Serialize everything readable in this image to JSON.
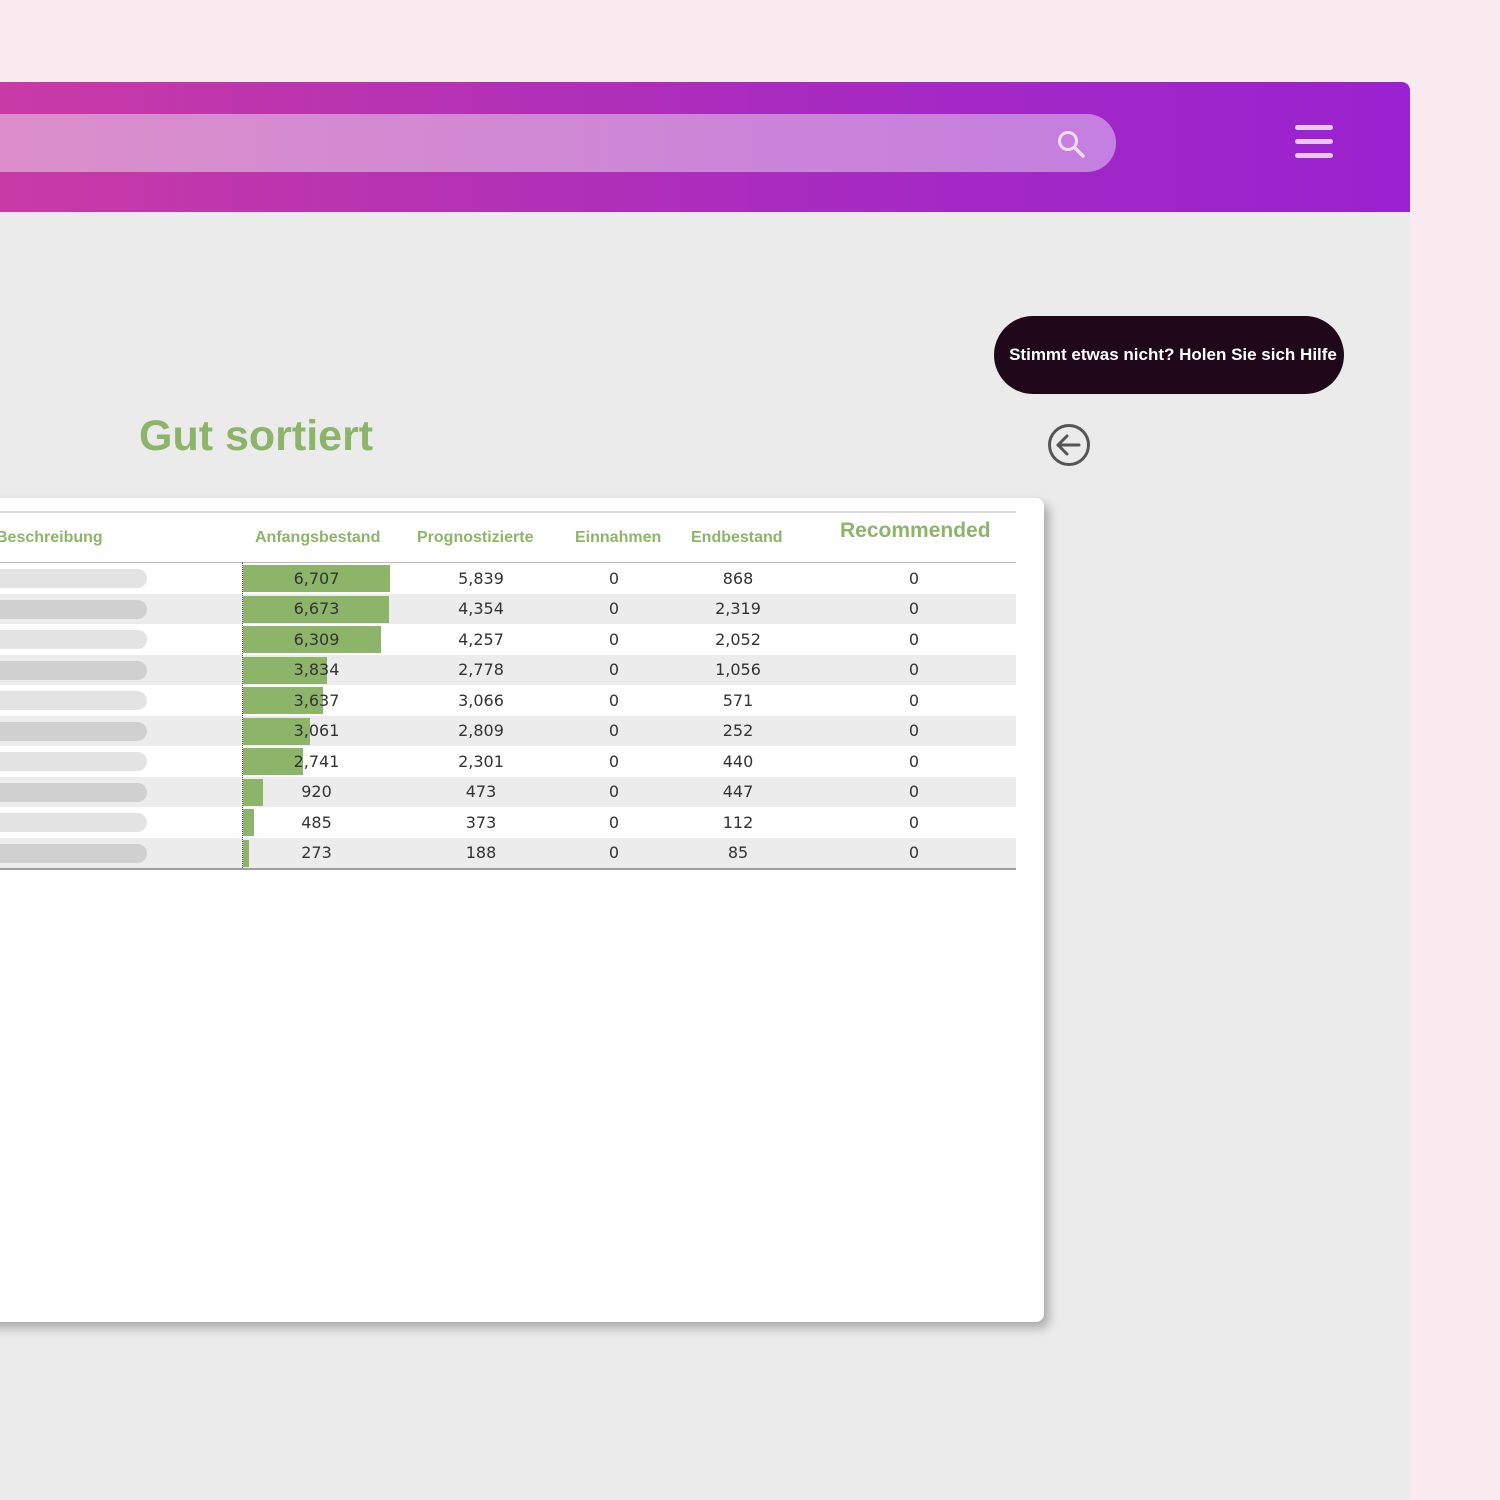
{
  "header": {
    "search": {
      "placeholder": "",
      "icon": "search-icon"
    },
    "menu_icon": "hamburger-menu-icon",
    "colors": {
      "gradient_start": "#c93aa6",
      "gradient_end": "#9a22d0"
    }
  },
  "help_button": {
    "label": "Stimmt etwas nicht? Holen Sie sich Hilfe"
  },
  "back_button": {
    "icon": "arrow-left-circle-icon"
  },
  "page": {
    "title": "Gut sortiert",
    "accent_color": "#8db56a"
  },
  "table": {
    "columns": {
      "beschreibung": "Beschreibung",
      "anfangsbestand": "Anfangsbestand",
      "prognostizierte": "Prognostizierte",
      "einnahmen": "Einnahmen",
      "endbestand": "Endbestand",
      "recommended": "Recommended"
    },
    "rows": [
      {
        "anfangsbestand": "6,707",
        "prognostizierte": "5,839",
        "einnahmen": "0",
        "endbestand": "868",
        "recommended": "0",
        "bar": 6707
      },
      {
        "anfangsbestand": "6,673",
        "prognostizierte": "4,354",
        "einnahmen": "0",
        "endbestand": "2,319",
        "recommended": "0",
        "bar": 6673
      },
      {
        "anfangsbestand": "6,309",
        "prognostizierte": "4,257",
        "einnahmen": "0",
        "endbestand": "2,052",
        "recommended": "0",
        "bar": 6309
      },
      {
        "anfangsbestand": "3,834",
        "prognostizierte": "2,778",
        "einnahmen": "0",
        "endbestand": "1,056",
        "recommended": "0",
        "bar": 3834
      },
      {
        "anfangsbestand": "3,637",
        "prognostizierte": "3,066",
        "einnahmen": "0",
        "endbestand": "571",
        "recommended": "0",
        "bar": 3637
      },
      {
        "anfangsbestand": "3,061",
        "prognostizierte": "2,809",
        "einnahmen": "0",
        "endbestand": "252",
        "recommended": "0",
        "bar": 3061
      },
      {
        "anfangsbestand": "2,741",
        "prognostizierte": "2,301",
        "einnahmen": "0",
        "endbestand": "440",
        "recommended": "0",
        "bar": 2741
      },
      {
        "anfangsbestand": "920",
        "prognostizierte": "473",
        "einnahmen": "0",
        "endbestand": "447",
        "recommended": "0",
        "bar": 920
      },
      {
        "anfangsbestand": "485",
        "prognostizierte": "373",
        "einnahmen": "0",
        "endbestand": "112",
        "recommended": "0",
        "bar": 485
      },
      {
        "anfangsbestand": "273",
        "prognostizierte": "188",
        "einnahmen": "0",
        "endbestand": "85",
        "recommended": "0",
        "bar": 273
      }
    ]
  }
}
